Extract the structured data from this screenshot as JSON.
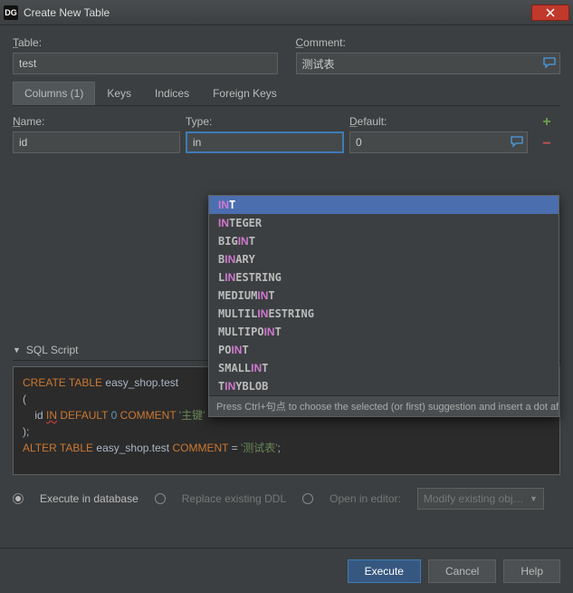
{
  "window": {
    "title": "Create New Table",
    "logo_text": "DG"
  },
  "form": {
    "table_label": "Table:",
    "table_value": "test",
    "comment_label": "Comment:",
    "comment_value": "测试表"
  },
  "tabs": [
    {
      "label": "Columns (1)",
      "active": true
    },
    {
      "label": "Keys"
    },
    {
      "label": "Indices"
    },
    {
      "label": "Foreign Keys"
    }
  ],
  "cols_header": {
    "name": "Name:",
    "type": "Type:",
    "default": "Default:"
  },
  "row": {
    "name": "id",
    "type": "in",
    "default": "0"
  },
  "autocomplete": {
    "items": [
      {
        "text": "INT",
        "hl": [
          0,
          1
        ]
      },
      {
        "text": "INTEGER",
        "hl": [
          0,
          1
        ]
      },
      {
        "text": "BIGINT",
        "hl": [
          3,
          4
        ]
      },
      {
        "text": "BINARY",
        "hl": [
          1,
          2
        ]
      },
      {
        "text": "LINESTRING",
        "hl": [
          1,
          2
        ]
      },
      {
        "text": "MEDIUMINT",
        "hl": [
          6,
          7
        ]
      },
      {
        "text": "MULTILINESTRING",
        "hl": [
          6,
          7
        ]
      },
      {
        "text": "MULTIPOINT",
        "hl": [
          7,
          8
        ]
      },
      {
        "text": "POINT",
        "hl": [
          2,
          3
        ]
      },
      {
        "text": "SMALLINT",
        "hl": [
          5,
          6
        ]
      },
      {
        "text": "TINYBLOB",
        "hl": [
          1,
          2
        ]
      }
    ],
    "hint": "Press Ctrl+句点 to choose the selected (or first) suggestion and insert a dot afterwards"
  },
  "script_section": {
    "label": "SQL Script"
  },
  "sql": {
    "l1a": "CREATE",
    "l1b": "TABLE",
    "l1c": "easy_shop.test",
    "l2": "(",
    "l3a": "id",
    "l3b": "IN",
    "l3c": "DEFAULT",
    "l3d": "0",
    "l3e": "COMMENT",
    "l3f": "'主键'",
    "l4": ");",
    "l5a": "ALTER",
    "l5b": "TABLE",
    "l5c": "easy_shop.test",
    "l5d": "COMMENT",
    "l5e": "=",
    "l5f": "'测试表'",
    "l5g": ";"
  },
  "opts": {
    "o1": "Execute in database",
    "o2": "Replace existing DDL",
    "o3": "Open in editor:",
    "modify": "Modify existing obj…"
  },
  "buttons": {
    "execute": "Execute",
    "cancel": "Cancel",
    "help": "Help"
  }
}
